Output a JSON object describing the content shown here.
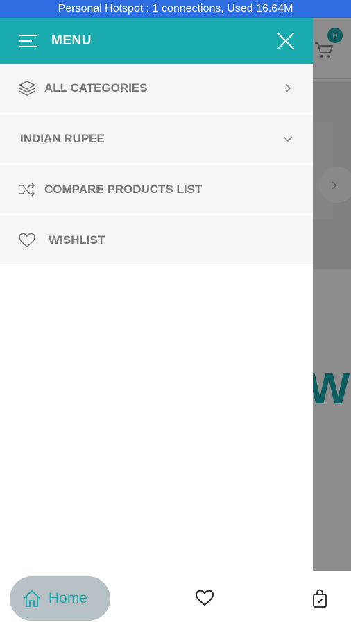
{
  "status_bar": {
    "text": "Personal Hotspot : 1 connections, Used 16.64M"
  },
  "background": {
    "cart_count": "0",
    "banner_letter": "W"
  },
  "drawer": {
    "title": "MENU",
    "items": [
      {
        "label": "ALL CATEGORIES",
        "icon": "layers-icon",
        "indicator": "chevron-right"
      },
      {
        "label": "INDIAN RUPEE",
        "icon": "none",
        "indicator": "chevron-down"
      },
      {
        "label": "COMPARE PRODUCTS LIST",
        "icon": "shuffle-icon",
        "indicator": "none"
      },
      {
        "label": "WISHLIST",
        "icon": "heart-icon",
        "indicator": "none"
      }
    ]
  },
  "bottom_nav": {
    "home_label": "Home"
  },
  "colors": {
    "accent": "#19abae",
    "status_bar": "#2f6ee0"
  }
}
